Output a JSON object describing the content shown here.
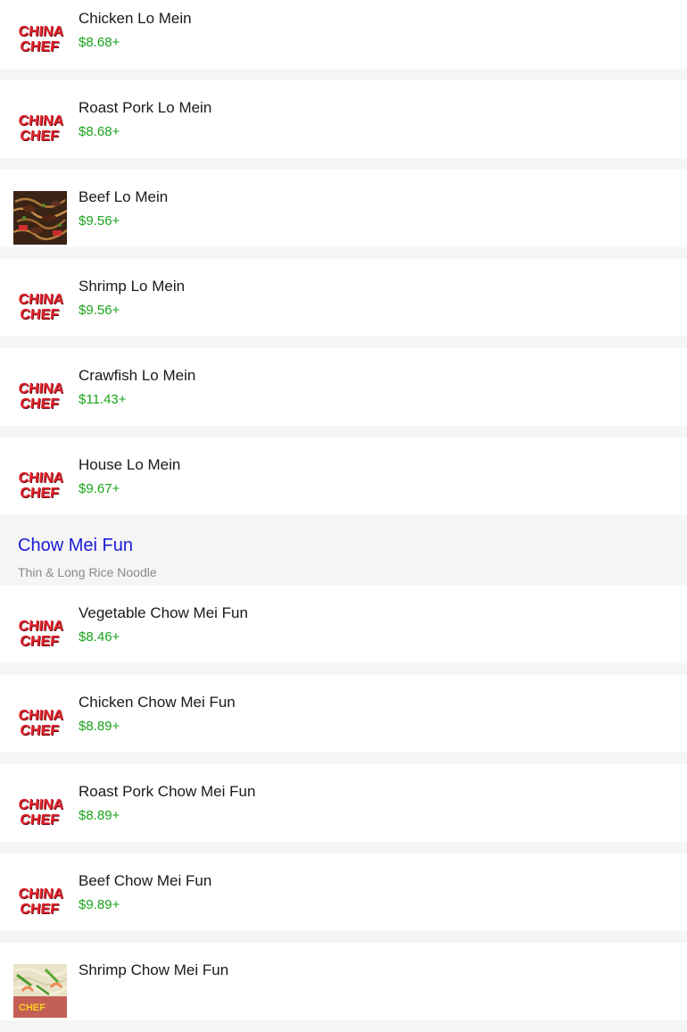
{
  "brand_logo": {
    "line1": "CHINA",
    "line2": "CHEF"
  },
  "group_one": [
    {
      "name": "Chicken Lo Mein",
      "price": "$8.68+",
      "image": "logo"
    },
    {
      "name": "Roast Pork Lo Mein",
      "price": "$8.68+",
      "image": "logo"
    },
    {
      "name": "Beef Lo Mein",
      "price": "$9.56+",
      "image": "photo-beef-noodles"
    },
    {
      "name": "Shrimp Lo Mein",
      "price": "$9.56+",
      "image": "logo"
    },
    {
      "name": "Crawfish Lo Mein",
      "price": "$11.43+",
      "image": "logo"
    },
    {
      "name": "House Lo Mein",
      "price": "$9.67+",
      "image": "logo"
    }
  ],
  "section": {
    "title": "Chow Mei Fun",
    "subtitle": "Thin & Long Rice Noodle"
  },
  "group_two": [
    {
      "name": "Vegetable Chow Mei Fun",
      "price": "$8.46+",
      "image": "logo"
    },
    {
      "name": "Chicken Chow Mei Fun",
      "price": "$8.89+",
      "image": "logo"
    },
    {
      "name": "Roast Pork Chow Mei Fun",
      "price": "$8.89+",
      "image": "logo"
    },
    {
      "name": "Beef Chow Mei Fun",
      "price": "$9.89+",
      "image": "logo"
    },
    {
      "name": "Shrimp Chow Mei Fun",
      "price": "",
      "image": "photo-shrimp-noodles"
    }
  ],
  "colors": {
    "price": "#1aa31a",
    "section_title": "#1a1ad6",
    "logo_red": "#e4212c"
  }
}
